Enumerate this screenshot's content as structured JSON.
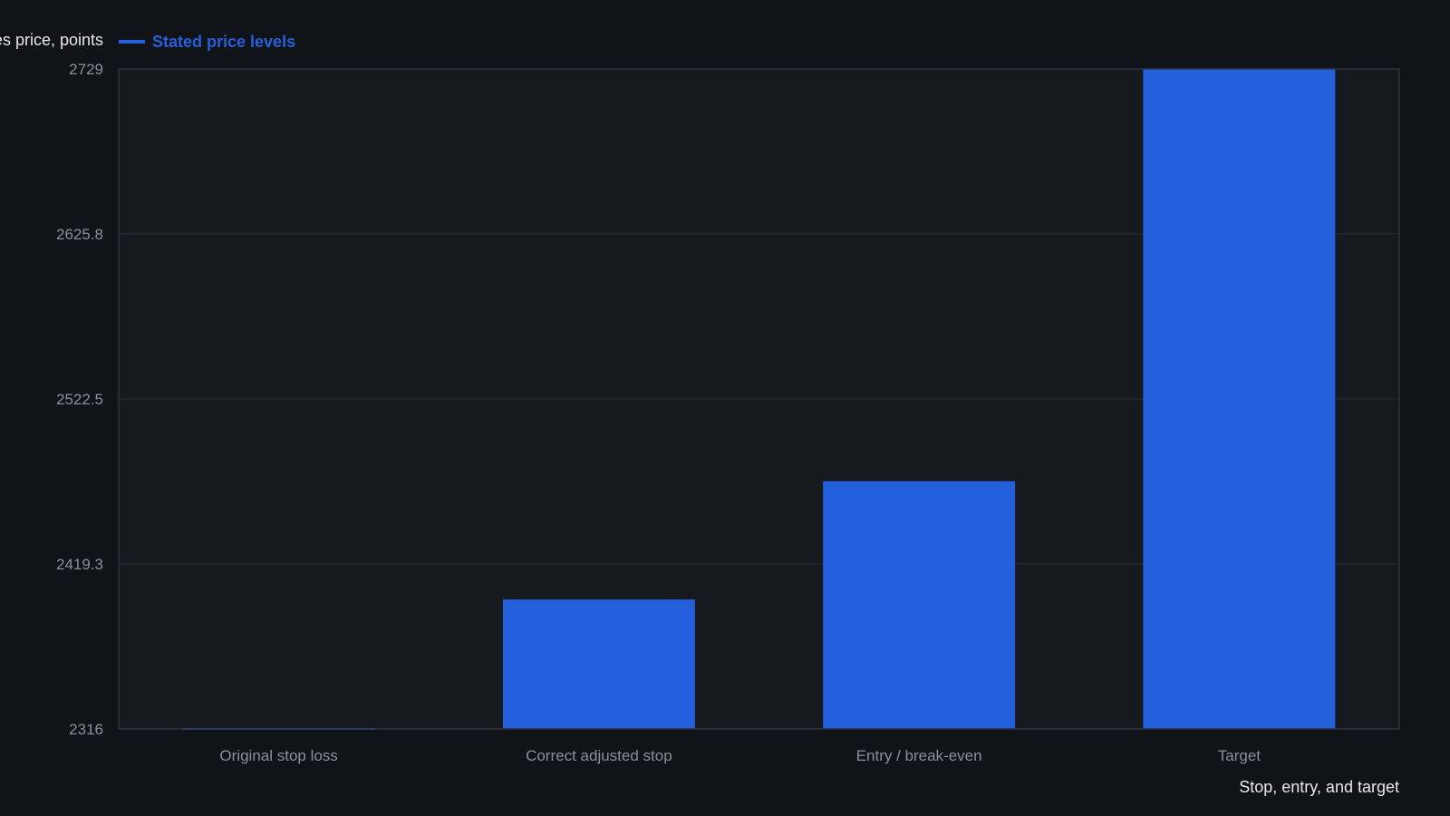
{
  "chart_data": {
    "type": "bar",
    "categories": [
      "Original stop loss",
      "Correct adjusted stop",
      "Entry / break-even",
      "Target"
    ],
    "series": [
      {
        "name": "Stated price levels",
        "values": [
          2316,
          2397,
          2471,
          2729
        ]
      }
    ],
    "xlabel": "Stop, entry, and target",
    "ylabel": "Futures price, points",
    "ylim": [
      2316,
      2729
    ],
    "yticks": [
      "2316",
      "2419.3",
      "2522.5",
      "2625.8",
      "2729"
    ],
    "grid": true,
    "legend_position": "top-left"
  },
  "colors": {
    "bar": "#2560dc",
    "background": "#101318",
    "plot_background": "#16191e"
  }
}
